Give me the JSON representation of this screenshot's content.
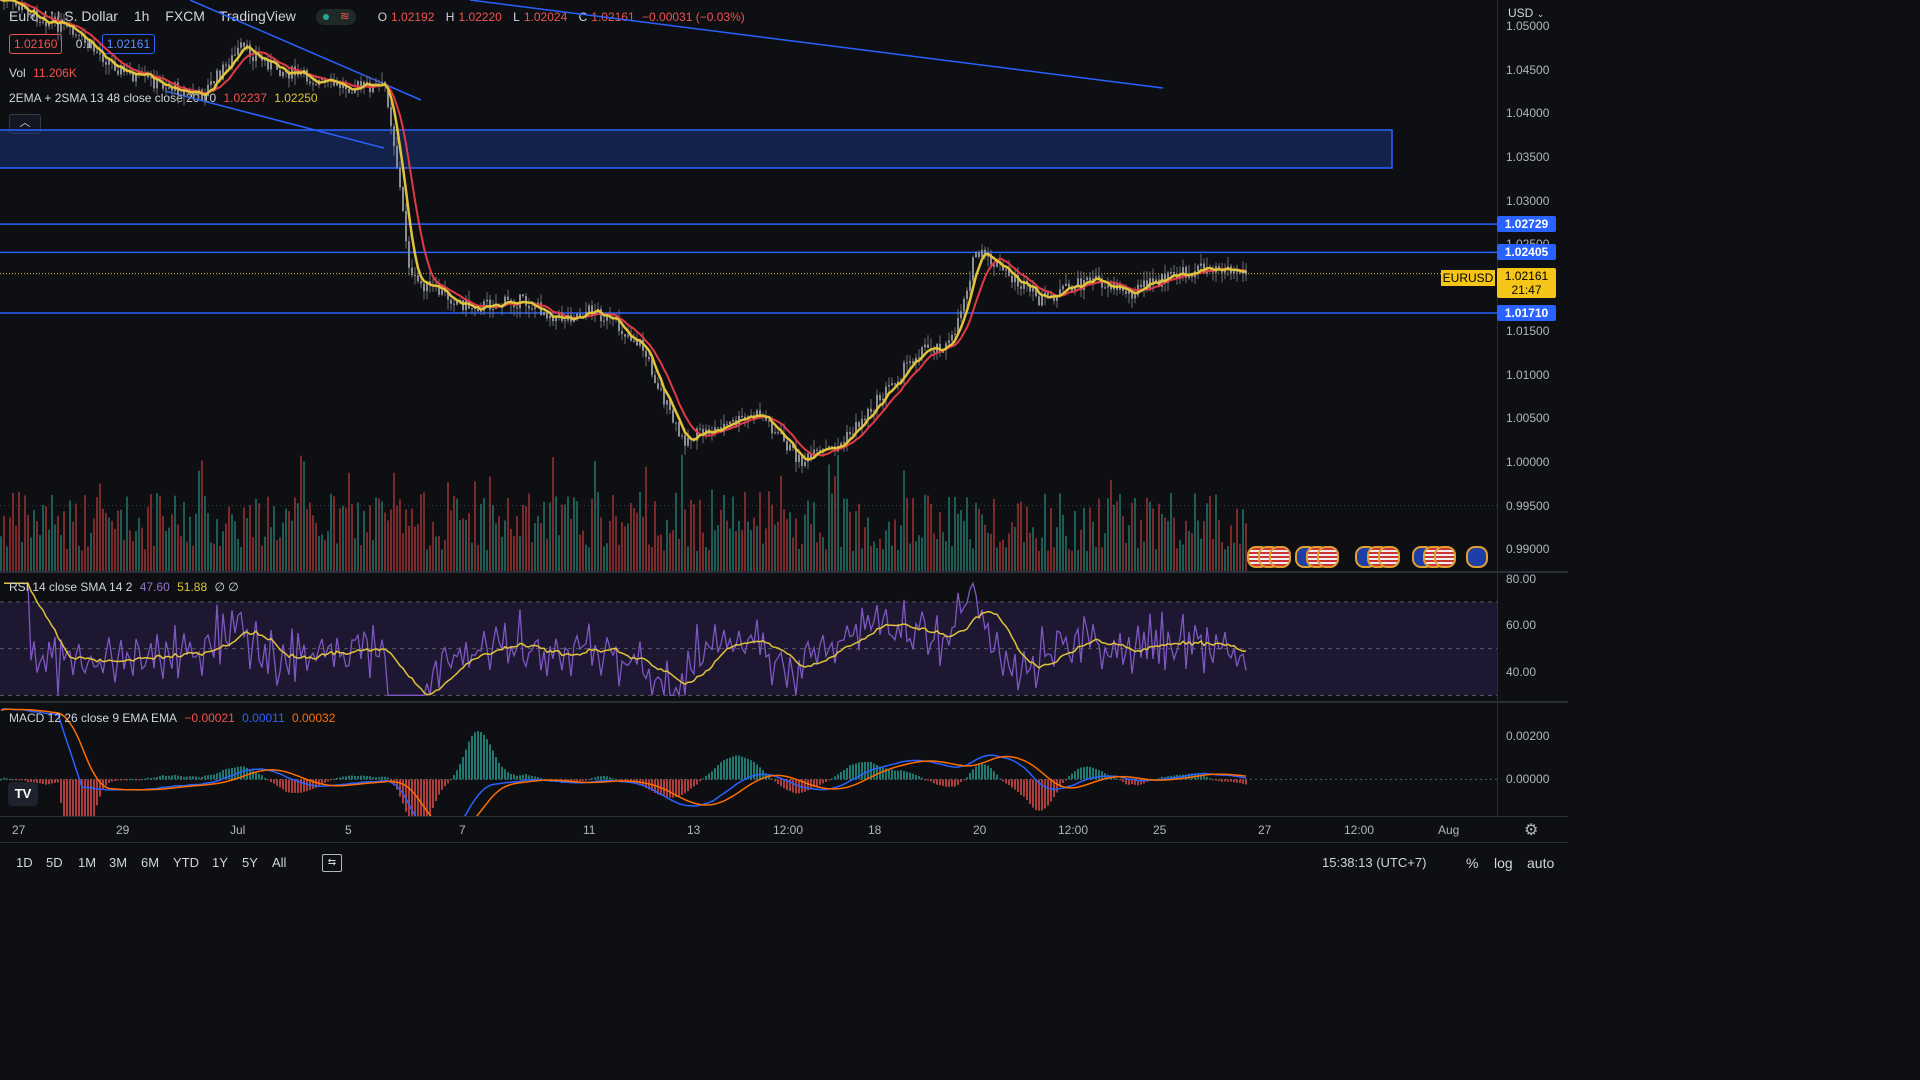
{
  "header": {
    "symbol": "Euro / U.S. Dollar",
    "interval": "1h",
    "source": "FXCM",
    "brand": "TradingView",
    "ohlc": {
      "o_label": "O",
      "o": "1.02192",
      "h_label": "H",
      "h": "1.02220",
      "l_label": "L",
      "l": "1.02024",
      "c_label": "C",
      "c": "1.02161",
      "change": "−0.00031 (−0.03%)"
    },
    "sell_price": "1.02160",
    "spread": "0.1",
    "buy_price": "1.02161"
  },
  "volume_legend": {
    "label": "Vol",
    "value": "11.206K"
  },
  "ema_legend": {
    "label": "2EMA + 2SMA 13 48 close close 20 10",
    "value1": "1.02237",
    "value2": "1.02250"
  },
  "rsi_legend": {
    "label": "RSI 14 close SMA 14 2",
    "value1": "47.60",
    "value2": "51.88",
    "extra": "∅ ∅"
  },
  "macd_legend": {
    "label": "MACD 12 26 close 9 EMA EMA",
    "value1": "−0.00021",
    "value2": "0.00011",
    "value3": "0.00032"
  },
  "price_axis": {
    "currency": "USD",
    "ticks": [
      "1.05000",
      "1.04500",
      "1.04000",
      "1.03500",
      "1.03000",
      "1.02500",
      "1.01500",
      "1.01000",
      "1.00500",
      "1.00000",
      "0.99500",
      "0.99000"
    ],
    "tags": [
      {
        "name": "level-1",
        "value": "1.02729",
        "price": 1.02729
      },
      {
        "name": "level-2",
        "value": "1.02405",
        "price": 1.02405
      },
      {
        "name": "level-3",
        "value": "1.01710",
        "price": 1.0171
      }
    ],
    "symbol_tag": "EURUSD",
    "last_price": "1.02161",
    "countdown": "21:47"
  },
  "rsi_axis": {
    "ticks": [
      "80.00",
      "60.00",
      "40.00"
    ]
  },
  "macd_axis": {
    "ticks": [
      "0.00200",
      "0.00000"
    ]
  },
  "time_axis": {
    "labels": [
      "27",
      "29",
      "Jul",
      "5",
      "7",
      "11",
      "13",
      "12:00",
      "18",
      "20",
      "12:00",
      "25",
      "27",
      "12:00",
      "Aug"
    ]
  },
  "bottom_bar": {
    "ranges": [
      "1D",
      "5D",
      "1M",
      "3M",
      "6M",
      "YTD",
      "1Y",
      "5Y",
      "All"
    ],
    "clock": "15:38:13 (UTC+7)",
    "percent": "%",
    "log": "log",
    "auto": "auto"
  },
  "colors": {
    "up": "#26a69a",
    "down": "#ef5350",
    "ema": "#e0c33a",
    "sma": "#e03a4a",
    "rsi": "#7e57c2",
    "rsi_ma": "#e0c33a",
    "macd": "#2962ff",
    "signal": "#ff6d00",
    "level": "#2962ff"
  },
  "chart_data": {
    "type": "line",
    "title": "Euro / U.S. Dollar · 1h · FXCM",
    "price_range": [
      0.9875,
      1.053
    ],
    "close_path": [
      {
        "x": "27",
        "y": 1.053
      },
      {
        "x": "28",
        "y": 1.05
      },
      {
        "x": "29",
        "y": 1.0445
      },
      {
        "x": "30",
        "y": 1.042
      },
      {
        "x": "Jul",
        "y": 1.0475
      },
      {
        "x": "2",
        "y": 1.045
      },
      {
        "x": "4",
        "y": 1.0432
      },
      {
        "x": "5",
        "y": 1.043
      },
      {
        "x": "5b",
        "y": 1.035
      },
      {
        "x": "6",
        "y": 1.021
      },
      {
        "x": "7",
        "y": 1.0178
      },
      {
        "x": "8",
        "y": 1.0185
      },
      {
        "x": "8b",
        "y": 1.0165
      },
      {
        "x": "11",
        "y": 1.0175
      },
      {
        "x": "11b",
        "y": 1.0135
      },
      {
        "x": "12",
        "y": 1.0025
      },
      {
        "x": "13",
        "y": 1.004
      },
      {
        "x": "13b",
        "y": 1.0055
      },
      {
        "x": "14",
        "y": 1.0
      },
      {
        "x": "15",
        "y": 1.002
      },
      {
        "x": "18",
        "y": 1.013
      },
      {
        "x": "19",
        "y": 1.0135
      },
      {
        "x": "19b",
        "y": 1.024
      },
      {
        "x": "20",
        "y": 1.023
      },
      {
        "x": "21",
        "y": 1.0185
      },
      {
        "x": "22",
        "y": 1.021
      },
      {
        "x": "22b",
        "y": 1.0195
      },
      {
        "x": "25",
        "y": 1.021
      },
      {
        "x": "26",
        "y": 1.0226
      },
      {
        "x": "26b",
        "y": 1.0216
      }
    ]
  }
}
